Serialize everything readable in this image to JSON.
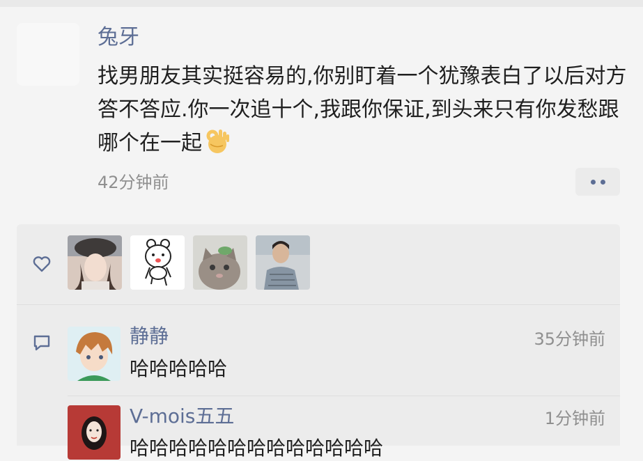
{
  "post": {
    "author": "兔牙",
    "text": "找男朋友其实挺容易的,你别盯着一个犹豫表白了以后对方答不答应.你一次追十个,我跟你保证,到头来只有你发愁跟哪个在一起",
    "emoji_icon": "ok-hand-emoji",
    "time": "42分钟前",
    "more_icon": "more-dots-icon"
  },
  "likes": {
    "icon": "heart-icon",
    "avatars": [
      "woman-hat-avatar",
      "cartoon-bear-avatar",
      "cat-avatar",
      "man-photo-avatar"
    ]
  },
  "comments": [
    {
      "name": "静静",
      "time": "35分钟前",
      "text": "哈哈哈哈哈",
      "avatar": "anime-boy-avatar"
    },
    {
      "name": "V-mois五五",
      "time": "1分钟前",
      "text": "哈哈哈哈哈哈哈哈哈哈哈哈哈",
      "avatar": "woman-illustration-avatar"
    }
  ],
  "comment_icon": "comment-bubble-icon",
  "colors": {
    "name": "#5d6e95",
    "background": "#f4f4f4",
    "panel": "#ececec"
  }
}
